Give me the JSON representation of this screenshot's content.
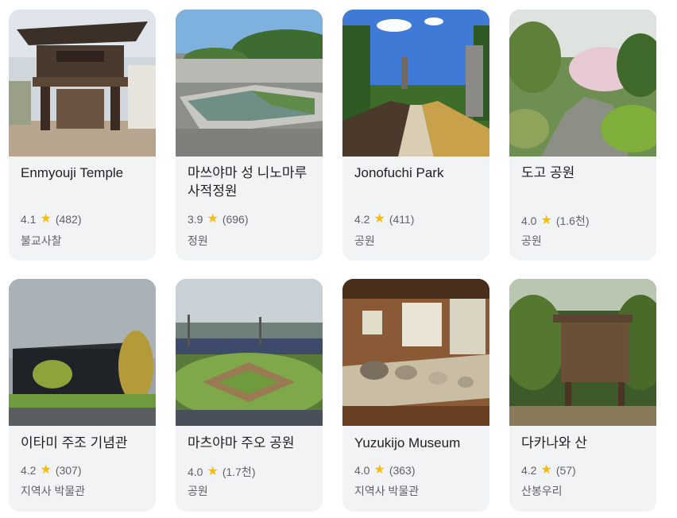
{
  "places": [
    {
      "title": "Enmyouji Temple",
      "rating": "4.1",
      "reviews": "(482)",
      "category": "불교사찰",
      "photo": "temple-gate-photo"
    },
    {
      "title": "마쓰야마 성 니노마루 사적정원",
      "rating": "3.9",
      "reviews": "(696)",
      "category": "정원",
      "photo": "garden-pool-photo"
    },
    {
      "title": "Jonofuchi Park",
      "rating": "4.2",
      "reviews": "(411)",
      "category": "공원",
      "photo": "park-bridge-photo"
    },
    {
      "title": "도고 공원",
      "rating": "4.0",
      "reviews": "(1.6천)",
      "category": "공원",
      "photo": "park-stream-photo"
    },
    {
      "title": "이타미 주조 기념관",
      "rating": "4.2",
      "reviews": "(307)",
      "category": "지역사 박물관",
      "photo": "museum-building-photo"
    },
    {
      "title": "마츠야마 주오 공원",
      "rating": "4.0",
      "reviews": "(1.7천)",
      "category": "공원",
      "photo": "baseball-stadium-photo"
    },
    {
      "title": "Yuzukijo Museum",
      "rating": "4.0",
      "reviews": "(363)",
      "category": "지역사 박물관",
      "photo": "museum-exhibit-photo"
    },
    {
      "title": "다카나와 산",
      "rating": "4.2",
      "reviews": "(57)",
      "category": "산봉우리",
      "photo": "mountain-sign-photo"
    }
  ],
  "icons": {
    "star": "star-icon"
  },
  "colors": {
    "card_bg": "#f1f3f4",
    "star": "#fbbc04",
    "title": "#202124",
    "meta": "#5f6368"
  }
}
